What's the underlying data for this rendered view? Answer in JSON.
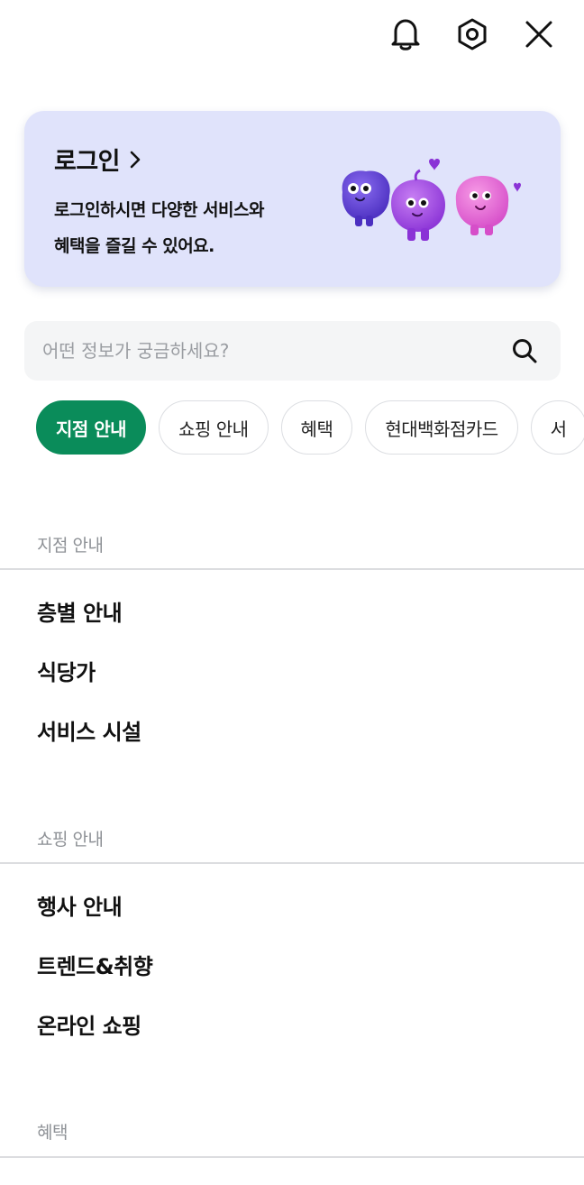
{
  "header": {
    "icons": [
      "bell-icon",
      "settings-hexagon-icon",
      "close-icon"
    ]
  },
  "login": {
    "title": "로그인",
    "desc_line1": "로그인하시면 다양한 서비스와",
    "desc_line2": "혜택을 즐길 수 있어요."
  },
  "search": {
    "placeholder": "어떤 정보가 궁금하세요?"
  },
  "chips": [
    {
      "label": "지점 안내",
      "active": true
    },
    {
      "label": "쇼핑 안내",
      "active": false
    },
    {
      "label": "혜택",
      "active": false
    },
    {
      "label": "현대백화점카드",
      "active": false
    },
    {
      "label": "서",
      "active": false
    }
  ],
  "sections": [
    {
      "label": "지점 안내",
      "items": [
        "층별 안내",
        "식당가",
        "서비스 시설"
      ]
    },
    {
      "label": "쇼핑 안내",
      "items": [
        "행사 안내",
        "트렌드&취향",
        "온라인 쇼핑"
      ]
    },
    {
      "label": "혜택",
      "items": []
    }
  ],
  "colors": {
    "accent_green": "#0a8c5a",
    "login_card_bg": "#e0e3fb",
    "search_bg": "#f4f5f6"
  }
}
